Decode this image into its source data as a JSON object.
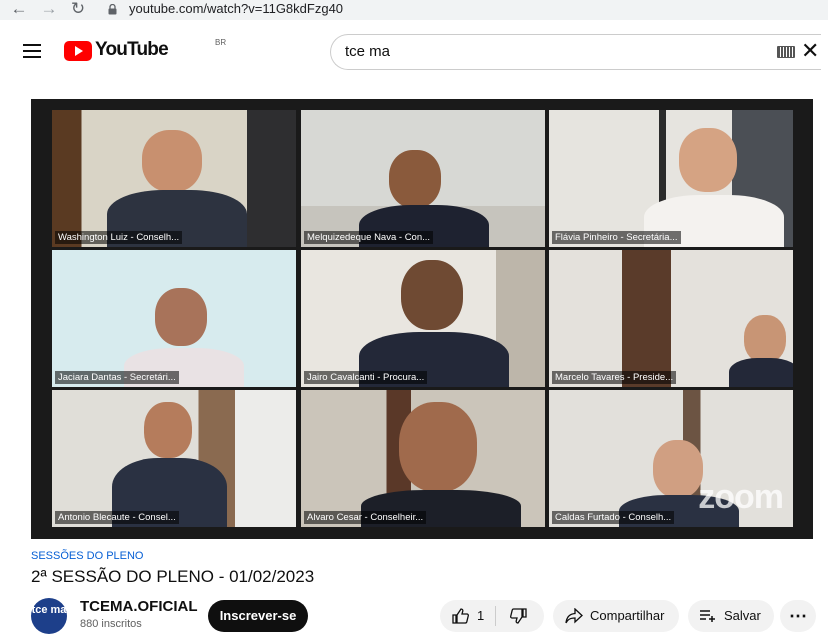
{
  "browser": {
    "url": "youtube.com/watch?v=11G8kdFzg40",
    "back_icon": "arrow-left",
    "forward_icon": "arrow-right",
    "reload_icon": "reload",
    "lock_icon": "lock"
  },
  "header": {
    "logo_text": "YouTube",
    "region": "BR",
    "search_value": "tce ma",
    "menu_icon": "hamburger",
    "keyboard_icon": "keyboard",
    "clear_icon": "close"
  },
  "video": {
    "watermark": "zoom",
    "participants": [
      {
        "name": "Washington Luiz - Conselh...",
        "active": false
      },
      {
        "name": "Melquizedeque Nava - Con...",
        "active": false
      },
      {
        "name": "Flávia Pinheiro - Secretária...",
        "active": false
      },
      {
        "name": "Jaciara Dantas - Secretári...",
        "active": false
      },
      {
        "name": "Jairo Cavalcanti - Procura...",
        "active": false
      },
      {
        "name": "Marcelo Tavares - Preside...",
        "active": false
      },
      {
        "name": "Antonio Blecaute - Consel...",
        "active": false
      },
      {
        "name": "Alvaro Cesar - Conselheir...",
        "active": true
      },
      {
        "name": "Caldas Furtado - Conselh...",
        "active": false
      }
    ]
  },
  "meta": {
    "category": "SESSÕES DO PLENO",
    "title": "2ª SESSÃO DO PLENO - 01/02/2023",
    "channel_name": "TCEMA.OFICIAL",
    "channel_avatar_text": "tce ma",
    "subscribers": "880 inscritos",
    "subscribe_label": "Inscrever-se",
    "like_count": "1",
    "share_label": "Compartilhar",
    "save_label": "Salvar",
    "more_icon": "more-horizontal"
  },
  "colors": {
    "youtube_red": "#ff0000",
    "link_blue": "#065fd4",
    "active_speaker": "#3ac53a"
  }
}
